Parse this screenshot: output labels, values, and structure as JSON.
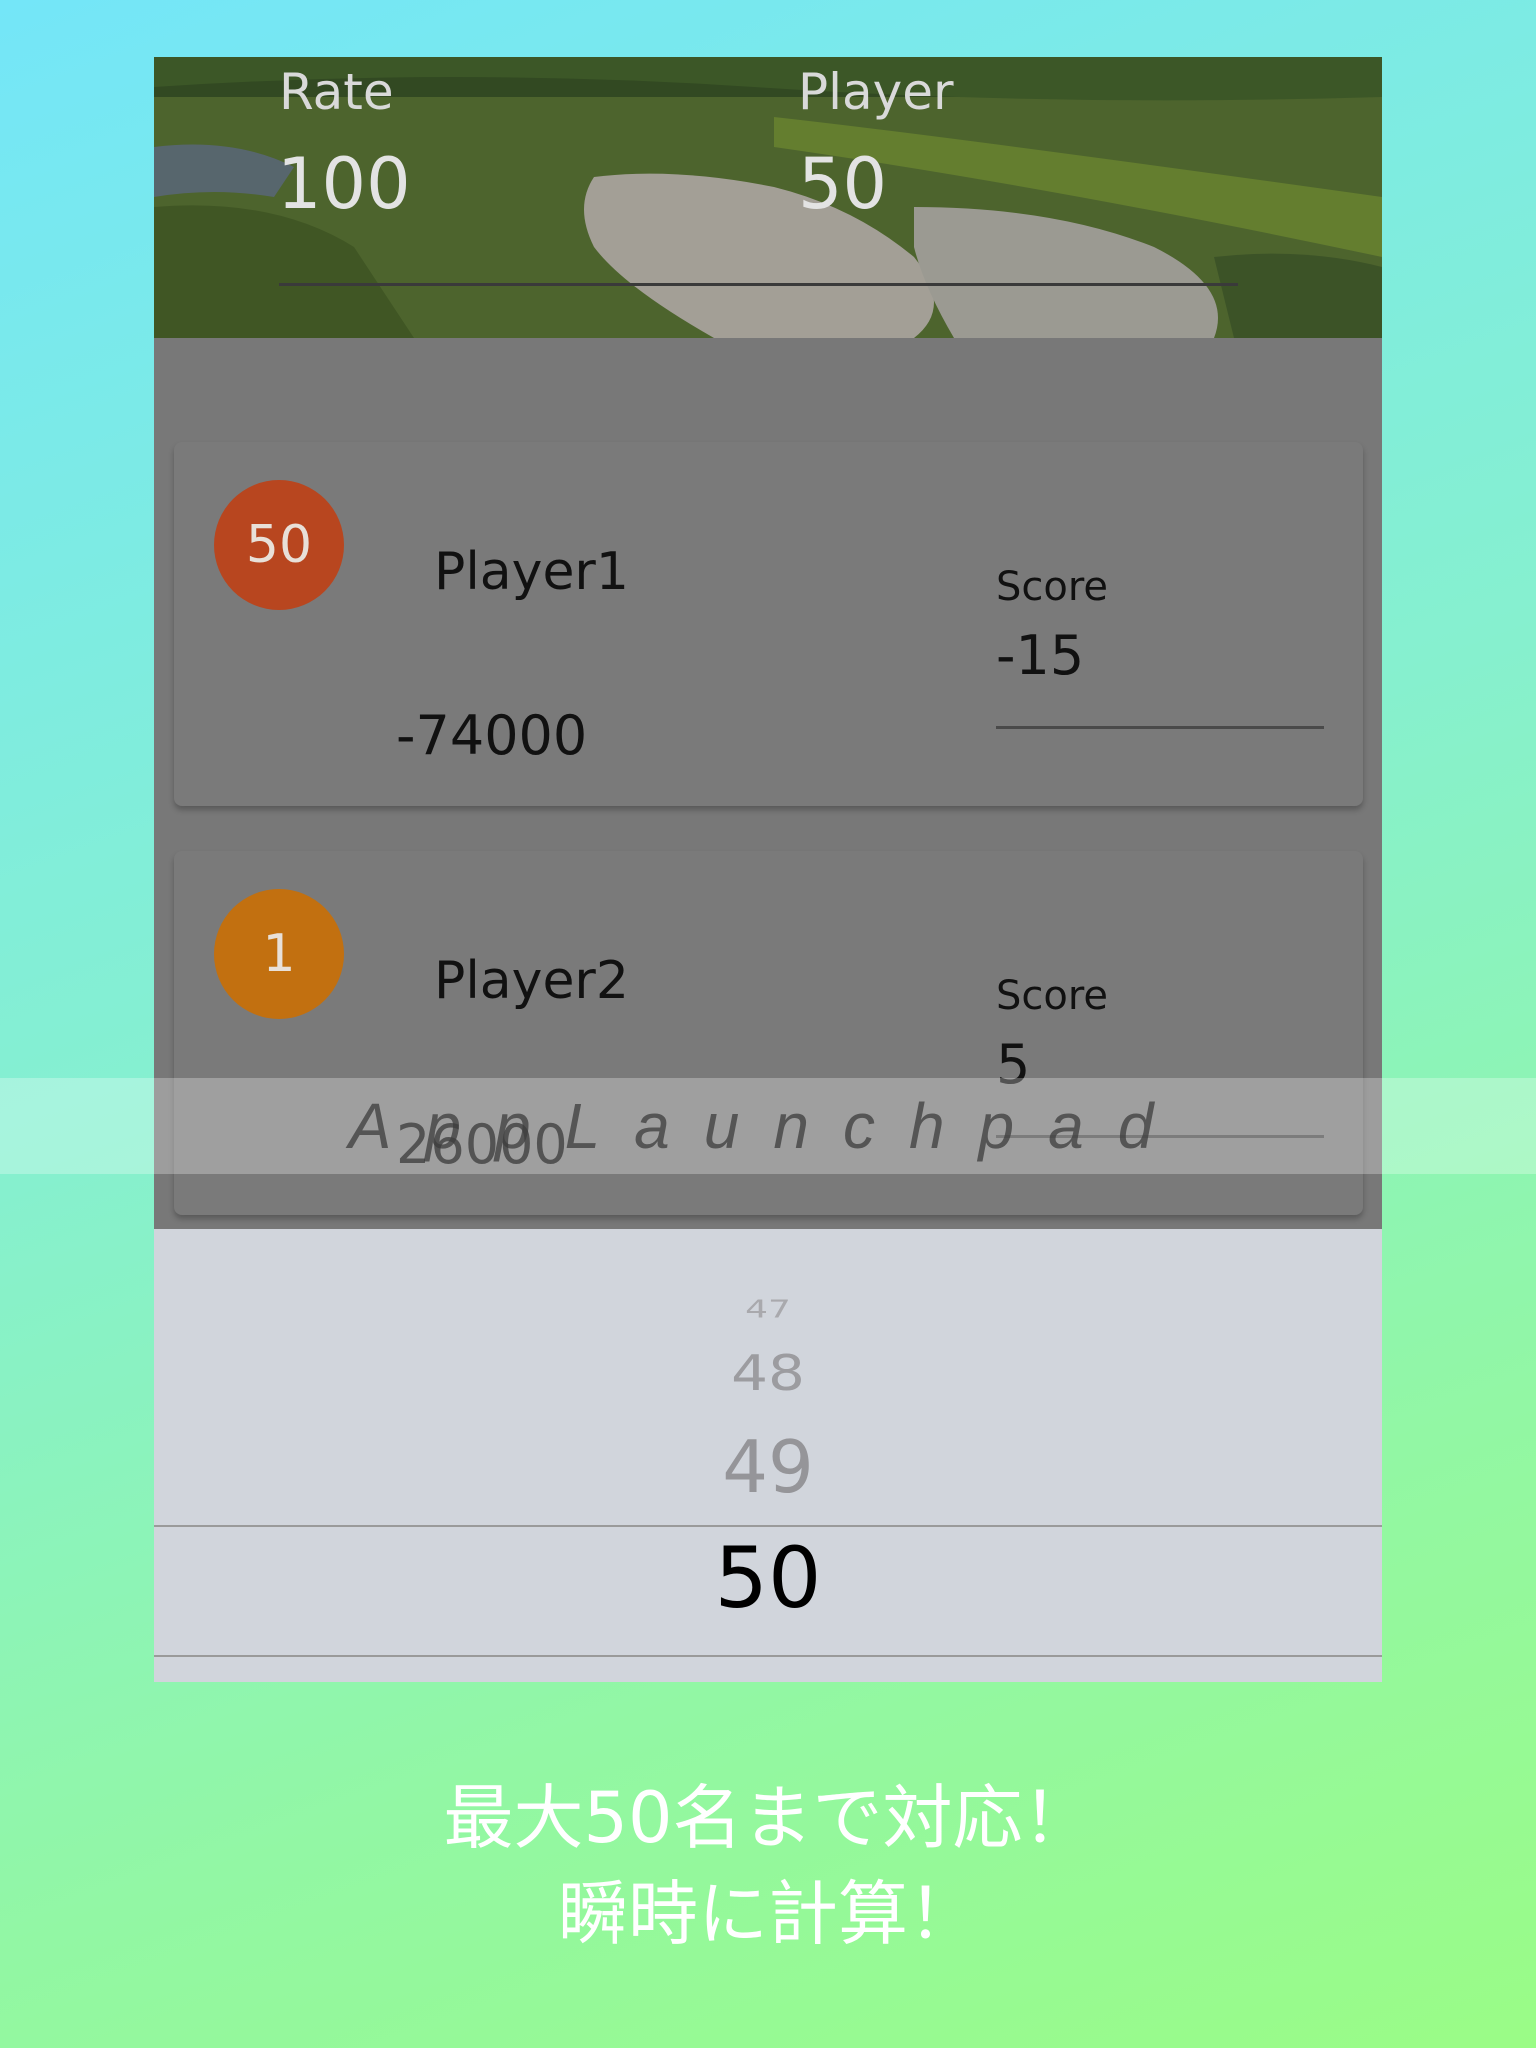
{
  "header": {
    "rate_label": "Rate",
    "rate_value": "100",
    "player_label": "Player",
    "player_value": "50"
  },
  "cards": [
    {
      "rank": "50",
      "rank_color": "#c0461f",
      "name": "Player1",
      "score_label": "Score",
      "score": "-15",
      "amount": "-74000"
    },
    {
      "rank": "1",
      "rank_color": "#c97310",
      "name": "Player2",
      "score_label": "Score",
      "score": "5",
      "amount": "26000"
    }
  ],
  "picker": {
    "items": [
      "47",
      "48",
      "49",
      "50"
    ],
    "selected": "50"
  },
  "watermark": "AppLaunchpad",
  "caption": {
    "line1": "最大50名まで対応！",
    "line2": "瞬時に計算！"
  },
  "colors": {
    "background_start": "#74e6f8",
    "background_end": "#9afc86",
    "overlay_gray": "#787878",
    "picker_bg": "#d1d5dc"
  }
}
